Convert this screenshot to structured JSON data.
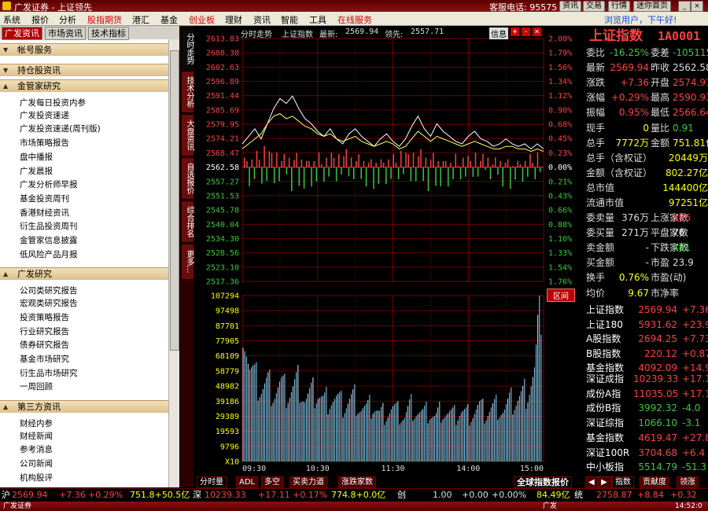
{
  "window": {
    "title": "广发证券 - 上证领先",
    "service_phone": "客服电话: 95575",
    "buttons": [
      "资讯",
      "交易",
      "行情",
      "迷你首页"
    ],
    "min": "_",
    "max": "□",
    "close": "×"
  },
  "menu": {
    "items": [
      "系统",
      "报价",
      "分析",
      "股指期货",
      "港汇",
      "基金",
      "创业板",
      "理财",
      "资讯",
      "智能",
      "工具",
      "在线服务"
    ],
    "red_items": [
      3,
      6,
      11
    ],
    "greeting": "浏览用户，下午好!"
  },
  "left": {
    "tabs": [
      "广发资讯",
      "市场资讯",
      "技术指标"
    ],
    "sections": [
      {
        "label": "帐号服务",
        "expanded": false,
        "items": []
      },
      {
        "label": "持仓股资讯",
        "expanded": false,
        "items": []
      },
      {
        "label": "金管家研究",
        "expanded": true,
        "items": [
          "广发每日投资内参",
          "广发投资速递",
          "广发投资速递(周刊版)",
          "市场策略报告",
          "盘中播报",
          "广发晨报",
          "广发分析师早报",
          "基金投资周刊",
          "香港财经资讯",
          "衍生品投资周刊",
          "金管家信息披露",
          "低风险产品月报"
        ]
      },
      {
        "label": "广发研究",
        "expanded": true,
        "items": [
          "公司类研究报告",
          "宏观类研究报告",
          "投资策略报告",
          "行业研究报告",
          "债券研究报告",
          "基金市场研究",
          "衍生品市场研究",
          "一周回顾"
        ]
      },
      {
        "label": "第三方资讯",
        "expanded": true,
        "items": [
          "财经内参",
          "财经新闻",
          "参考消息",
          "公司新闻",
          "机构股评"
        ]
      }
    ]
  },
  "vtabs": [
    "分时走势",
    "技术分析",
    "大盘资讯",
    "自选报价",
    "综合排名",
    "更多..."
  ],
  "chart_header": {
    "mode": "分时走势",
    "name": "上证指数",
    "latest_label": "最新:",
    "latest": "2569.94",
    "lead_label": "领先:",
    "lead": "2557.71",
    "buttons": [
      "信息",
      "+",
      "-",
      "×"
    ]
  },
  "chart_data": {
    "type": "line",
    "title": "上证指数",
    "prev_close": 2562.58,
    "price_ticks": [
      "2613.83",
      "2608.38",
      "2602.63",
      "2596.89",
      "2591.44",
      "2585.69",
      "2579.95",
      "2574.21",
      "2568.47",
      "2562.58",
      "2557.27",
      "2551.53",
      "2545.78",
      "2540.04",
      "2534.30",
      "2528.56",
      "2523.10",
      "2517.36"
    ],
    "pct_ticks": [
      "2.00%",
      "1.79%",
      "1.56%",
      "1.34%",
      "1.12%",
      "0.90%",
      "0.68%",
      "0.45%",
      "0.23%",
      "0.00%",
      "0.21%",
      "0.43%",
      "0.66%",
      "0.88%",
      "1.10%",
      "1.33%",
      "1.54%",
      "1.76%"
    ],
    "volume_ticks": [
      "107294",
      "97498",
      "87701",
      "77905",
      "68109",
      "58779",
      "48982",
      "39186",
      "29389",
      "19593",
      "9796",
      "X10"
    ],
    "time_ticks": [
      "09:30",
      "10:30",
      "11:30",
      "14:00",
      "15:00"
    ],
    "series": [
      {
        "values": [
          2572,
          2575,
          2578,
          2574,
          2580,
          2586,
          2590,
          2588,
          2591,
          2586,
          2582,
          2580,
          2577,
          2575,
          2578,
          2574,
          2572,
          2576,
          2578,
          2575,
          2573,
          2571,
          2574,
          2576,
          2573,
          2571,
          2574,
          2579,
          2583,
          2578,
          2575,
          2580,
          2577,
          2575,
          2573,
          2572,
          2575,
          2577,
          2574,
          2573,
          2571,
          2572,
          2574,
          2572,
          2571,
          2572,
          2570,
          2572,
          2570
        ]
      },
      {
        "values": [
          2570,
          2572,
          2574,
          2576,
          2580,
          2583,
          2584,
          2582,
          2583,
          2581,
          2579,
          2578,
          2576,
          2575,
          2576,
          2574,
          2573,
          2574,
          2575,
          2573,
          2572,
          2571,
          2572,
          2573,
          2572,
          2570,
          2571,
          2574,
          2577,
          2575,
          2573,
          2575,
          2574,
          2573,
          2572,
          2571,
          2572,
          2573,
          2572,
          2571,
          2570,
          2570,
          2571,
          2571,
          2570,
          2570,
          2569,
          2570,
          2569
        ]
      }
    ],
    "volume_values": [
      98000,
      60000,
      52000,
      48000,
      50000,
      46000,
      49000,
      44000,
      47000,
      52000,
      40000,
      43000,
      45000,
      38000,
      42000,
      40000,
      36000,
      39000,
      41000,
      35000,
      33000,
      37000,
      30000,
      32000,
      34000,
      31000,
      29000,
      36000,
      33000,
      30000,
      32000,
      28000,
      34000,
      31000,
      29000,
      33000,
      30000,
      32000,
      35000,
      31000,
      34000,
      36000,
      33000,
      38000,
      40000,
      42000,
      48000,
      58000,
      105000
    ],
    "interval_label": "区间"
  },
  "bottom_tabs": {
    "left": [
      "分时量",
      "ADL",
      "多空",
      "买卖力道",
      "涨跌家数"
    ],
    "mid": "全球指数报价",
    "right": [
      "指数",
      "贡献度",
      "领涨"
    ]
  },
  "quote": {
    "name": "上证指数",
    "code": "1A0001",
    "rows": [
      {
        "l1": "委比",
        "v1": "-16.25%",
        "v1c": "dn",
        "l2": "委差",
        "v2": "-105115",
        "v2c": "dn"
      },
      {
        "l1": "最新",
        "v1": "2569.94",
        "v1c": "up",
        "l2": "昨收",
        "v2": "2562.58",
        "v2c": "wt"
      },
      {
        "l1": "涨跌",
        "v1": "+7.36",
        "v1c": "up",
        "l2": "开盘",
        "v2": "2574.91",
        "v2c": "up"
      },
      {
        "l1": "涨幅",
        "v1": "+0.29%",
        "v1c": "up",
        "l2": "最高",
        "v2": "2590.93",
        "v2c": "up"
      },
      {
        "l1": "振幅",
        "v1": "0.95%",
        "v1c": "up",
        "l2": "最低",
        "v2": "2566.64",
        "v2c": "up"
      },
      {
        "l1": "现手",
        "v1": "0",
        "v1c": "yel",
        "l2": "量比",
        "v2": "0.91",
        "v2c": "dn"
      },
      {
        "l1": "总手",
        "v1": "7772万",
        "v1c": "yel",
        "l2": "金额",
        "v2": "751.81亿",
        "v2c": "yel"
      },
      {
        "l1": "总手（含权证）",
        "v1": "20449万",
        "v1c": "yel",
        "l2": "",
        "v2": "",
        "v2c": "wt"
      },
      {
        "l1": "金额（含权证）",
        "v1": "802.27亿",
        "v1c": "yel",
        "l2": "",
        "v2": "",
        "v2c": "wt"
      },
      {
        "l1": "总市值",
        "v1": "144400亿",
        "v1c": "yel",
        "l2": "",
        "v2": "",
        "v2c": "wt"
      },
      {
        "l1": "流通市值",
        "v1": "97251亿",
        "v1c": "yel",
        "l2": "",
        "v2": "",
        "v2c": "wt"
      },
      {
        "l1": "委卖量",
        "v1": "376万",
        "v1c": "wt",
        "l2": "上涨家数",
        "v2": "386",
        "v2c": "up"
      },
      {
        "l1": "委买量",
        "v1": "271万",
        "v1c": "wt",
        "l2": "平盘家数",
        "v2": "76",
        "v2c": "wt"
      },
      {
        "l1": "卖金额",
        "v1": "-",
        "v1c": "wt",
        "l2": "下跌家数",
        "v2": "481",
        "v2c": "dn"
      },
      {
        "l1": "买金额",
        "v1": "-",
        "v1c": "wt",
        "l2": "市盈",
        "v2": "23.9",
        "v2c": "wt"
      },
      {
        "l1": "换手",
        "v1": "0.76%",
        "v1c": "yel",
        "l2": "市盈(动)",
        "v2": "",
        "v2c": "wt"
      },
      {
        "l1": "均价",
        "v1": "9.67",
        "v1c": "yel",
        "l2": "市净率",
        "v2": "",
        "v2c": "wt"
      }
    ],
    "indices_a": [
      {
        "name": "上证指数",
        "v": "2569.94",
        "c": "+7.36"
      },
      {
        "name": "上证180",
        "v": "5931.62",
        "c": "+23.97"
      },
      {
        "name": "A股指数",
        "v": "2694.25",
        "c": "+7.73"
      },
      {
        "name": "B股指数",
        "v": "220.12",
        "c": "+0.87"
      },
      {
        "name": "基金指数",
        "v": "4092.09",
        "c": "+14.9"
      }
    ],
    "indices_b": [
      {
        "name": "深证成指",
        "v": "10239.33",
        "c": "+17.11",
        "cc": "up"
      },
      {
        "name": "成份A指",
        "v": "11035.05",
        "c": "+17.1",
        "cc": "up"
      },
      {
        "name": "成份B指",
        "v": "3992.32",
        "c": "-4.0",
        "cc": "dn"
      },
      {
        "name": "深证综指",
        "v": "1066.10",
        "c": "-3.1",
        "cc": "dn"
      },
      {
        "name": "基金指数",
        "v": "4619.47",
        "c": "+27.8",
        "cc": "up"
      },
      {
        "name": "深证100R",
        "v": "3704.68",
        "c": "+6.4",
        "cc": "up"
      },
      {
        "name": "中小板指",
        "v": "5514.79",
        "c": "-51.3",
        "cc": "dn"
      }
    ]
  },
  "status": {
    "sh_label": "沪",
    "sh_val": "2569.94",
    "sh_chg": "+7.36",
    "sh_pct": "+0.29%",
    "sh_amt": "751.8+50.5亿",
    "sz_label": "深",
    "sz_val": "10239.33",
    "sz_chg": "+17.11",
    "sz_pct": "+0.17%",
    "sz_amt": "774.8+0.0亿",
    "cy_label": "创",
    "cy_val": "1.00",
    "cy_chg": "+0.00",
    "cy_pct": "+0.00%",
    "cy_amt": "84.49亿",
    "zs_label": "统",
    "zs_val": "2758.87",
    "zs_chg": "+8.84",
    "zs_pct": "+0.32"
  },
  "taskbar": {
    "left": "广发证券",
    "mid": "广发",
    "time": "14:52:0"
  },
  "colors": {
    "up": "#ff4040",
    "down": "#39c839",
    "grid": "#7a0000",
    "bg": "#000000"
  }
}
